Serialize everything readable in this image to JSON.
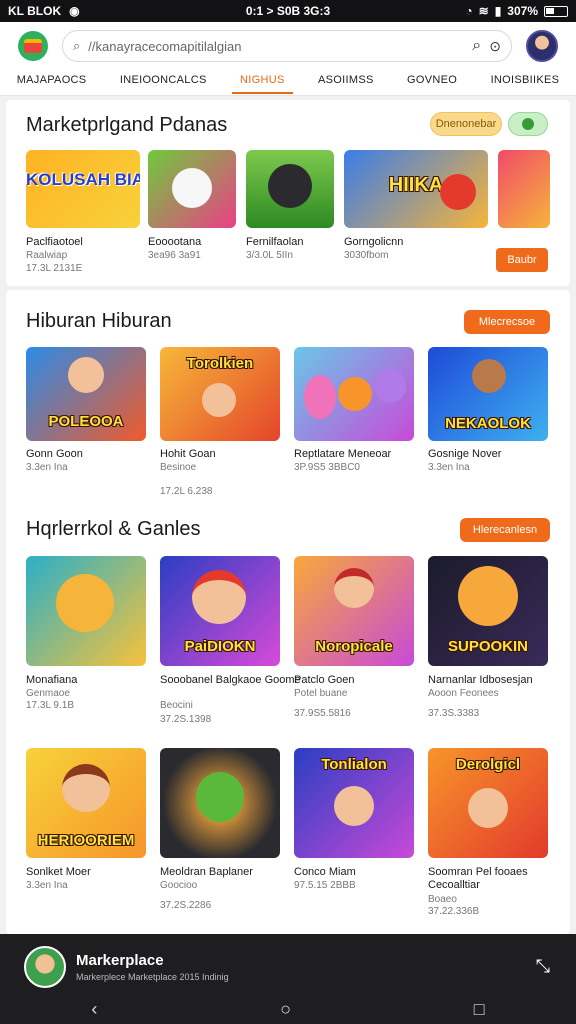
{
  "status_bar": {
    "left": "KL BLOK",
    "time": "0:1 > S0B 3G:3",
    "battery": "307%"
  },
  "topbar": {
    "search_placeholder": "//kanayracecomapitilalgian"
  },
  "tabs": [
    {
      "label": "MAJAPAOCS"
    },
    {
      "label": "INEIOONCALCS"
    },
    {
      "label": "NIGHUS"
    },
    {
      "label": "ASOIIMSS"
    },
    {
      "label": "GOVNEO"
    },
    {
      "label": "INOISBIIKES"
    }
  ],
  "section1": {
    "title": "Marketprlgand Pdanas",
    "pill_yellow": "Dnenonebar",
    "pill_green": "",
    "cta": "Baubr",
    "games": [
      {
        "tile_text": "KOLUSAH BIAORA",
        "name": "Paclfiaotoel",
        "sub1": "Raalwiap",
        "sub2": "17.3L 2131E"
      },
      {
        "tile_text": "",
        "name": "Eooootana",
        "sub1": "3ea96 3a91",
        "sub2": ""
      },
      {
        "tile_text": "",
        "name": "Fernilfaolan",
        "sub1": "3/3.0L 5IIn",
        "sub2": ""
      },
      {
        "tile_text": "HIIKA",
        "name": "Gorngolicnn",
        "sub1": "3030fbom",
        "sub2": ""
      },
      {
        "tile_text": "",
        "name": "",
        "sub1": "",
        "sub2": ""
      }
    ]
  },
  "section2": {
    "title": "Hiburan Hiburan",
    "cta": "Mlecrecsoe",
    "games": [
      {
        "tile_text": "POLEOOA",
        "name": "Gonn Goon",
        "sub1": "3.3en Ina",
        "sub2": ""
      },
      {
        "tile_text": "Torolkien",
        "name": "Hohit Goan",
        "sub1": "Besinoe",
        "sub2": "17.2L 6.238"
      },
      {
        "tile_text": "",
        "name": "Reptlatare Meneoar",
        "sub1": "3P.9S5 3BBC0",
        "sub2": ""
      },
      {
        "tile_text": "NEKAOLOK",
        "name": "Gosnige Nover",
        "sub1": "3.3en Ina",
        "sub2": ""
      }
    ]
  },
  "section3": {
    "title": "Hqrlerrkol & Ganles",
    "cta": "Hlerecanlesn",
    "games": [
      {
        "tile_text": "",
        "name": "Monafiana",
        "sub1": "Genmaoe",
        "sub2": "17.3L 9.1B"
      },
      {
        "tile_text": "PaiDIOKN",
        "name": "Sooobanel Balgkaoe Goome",
        "sub1": "Beocini",
        "sub2": "37.2S.1398"
      },
      {
        "tile_text": "Noropicale",
        "name": "Patclo Goen",
        "sub1": "Potel buane",
        "sub2": "37.9S5.5816"
      },
      {
        "tile_text": "SUPOOKIN",
        "name": "Narnanlar Idbosesjan",
        "sub1": "Aooon Feonees",
        "sub2": "37.3S.3383"
      }
    ]
  },
  "section4": {
    "games": [
      {
        "tile_text": "HERIOORIEM",
        "name": "Sonlket Moer",
        "sub1": "3.3en Ina",
        "sub2": ""
      },
      {
        "tile_text": "",
        "name": "Meoldran Baplaner",
        "sub1": "Goocioo",
        "sub2": "37.2S.2286"
      },
      {
        "tile_text": "Tonlialon",
        "name": "Conco Miam",
        "sub1": "97.5.15 2BBB",
        "sub2": ""
      },
      {
        "tile_text": "Derolgicl",
        "name": "Soomran Pel fooaes Cecoalltiar",
        "sub1": "Boaeo",
        "sub2": "37.22.336B"
      }
    ]
  },
  "dock": {
    "title": "Markerplace",
    "subtitle": "Markerplece Marketplace 2015 Indinig"
  }
}
